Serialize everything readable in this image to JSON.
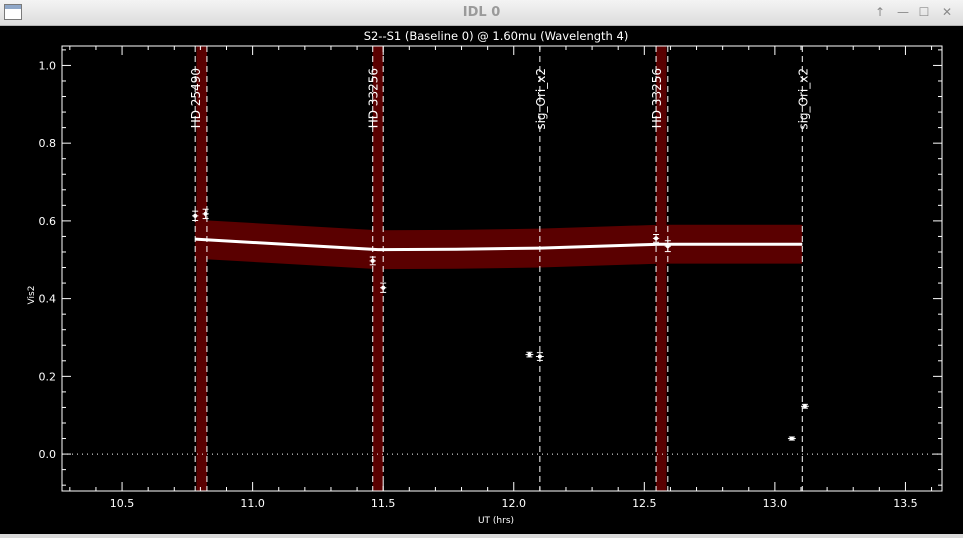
{
  "window": {
    "title": "IDL 0",
    "buttons": [
      "↑",
      "—",
      "☐",
      "✕"
    ]
  },
  "chart_data": {
    "type": "scatter",
    "title": "S2--S1 (Baseline 0) @ 1.60mu (Wavelength 4)",
    "xlabel": "UT (hrs)",
    "ylabel": "Vis2",
    "xlim": [
      10.27,
      13.64
    ],
    "ylim": [
      -0.095,
      1.05
    ],
    "xticks": [
      "10.5",
      "11.0",
      "11.5",
      "12.0",
      "12.5",
      "13.0",
      "13.5"
    ],
    "yticks": [
      "0.0",
      "0.2",
      "0.4",
      "0.6",
      "0.8",
      "1.0"
    ],
    "zero_line": 0.0,
    "calibrator_bands": [
      {
        "x": 10.805,
        "halfwidth": 0.02
      },
      {
        "x": 11.48,
        "halfwidth": 0.02
      },
      {
        "x": 12.565,
        "halfwidth": 0.02
      }
    ],
    "markers": [
      {
        "x": 10.78,
        "label": "HD 25490"
      },
      {
        "x": 11.46,
        "label": "HD 33256"
      },
      {
        "x": 12.1,
        "label": "sig_Ori_x2"
      },
      {
        "x": 12.545,
        "label": "HD 33256"
      },
      {
        "x": 13.105,
        "label": "sig_Ori_x2"
      }
    ],
    "extra_dashed_x": [
      10.825,
      11.5,
      12.59
    ],
    "transfer_function": {
      "x": [
        10.78,
        11.48,
        11.78,
        12.1,
        12.56,
        13.105
      ],
      "y": [
        0.553,
        0.526,
        0.527,
        0.53,
        0.54,
        0.54
      ],
      "err": 0.05
    },
    "points": [
      {
        "x": 10.78,
        "y": 0.613,
        "yerr": 0.012,
        "xerr": 0.012
      },
      {
        "x": 10.82,
        "y": 0.618,
        "yerr": 0.012,
        "xerr": 0.012
      },
      {
        "x": 11.46,
        "y": 0.497,
        "yerr": 0.01,
        "xerr": 0.012
      },
      {
        "x": 11.5,
        "y": 0.428,
        "yerr": 0.012,
        "xerr": 0.012
      },
      {
        "x": 12.06,
        "y": 0.256,
        "yerr": 0.006,
        "xerr": 0.015
      },
      {
        "x": 12.1,
        "y": 0.251,
        "yerr": 0.01,
        "xerr": 0.015
      },
      {
        "x": 12.545,
        "y": 0.555,
        "yerr": 0.01,
        "xerr": 0.012
      },
      {
        "x": 12.59,
        "y": 0.535,
        "yerr": 0.014,
        "xerr": 0.012
      },
      {
        "x": 13.065,
        "y": 0.04,
        "yerr": 0.004,
        "xerr": 0.015
      },
      {
        "x": 13.115,
        "y": 0.123,
        "yerr": 0.005,
        "xerr": 0.015
      }
    ],
    "colors": {
      "background": "#000000",
      "foreground": "#ffffff",
      "band": "#5a0000"
    },
    "grid": false
  }
}
